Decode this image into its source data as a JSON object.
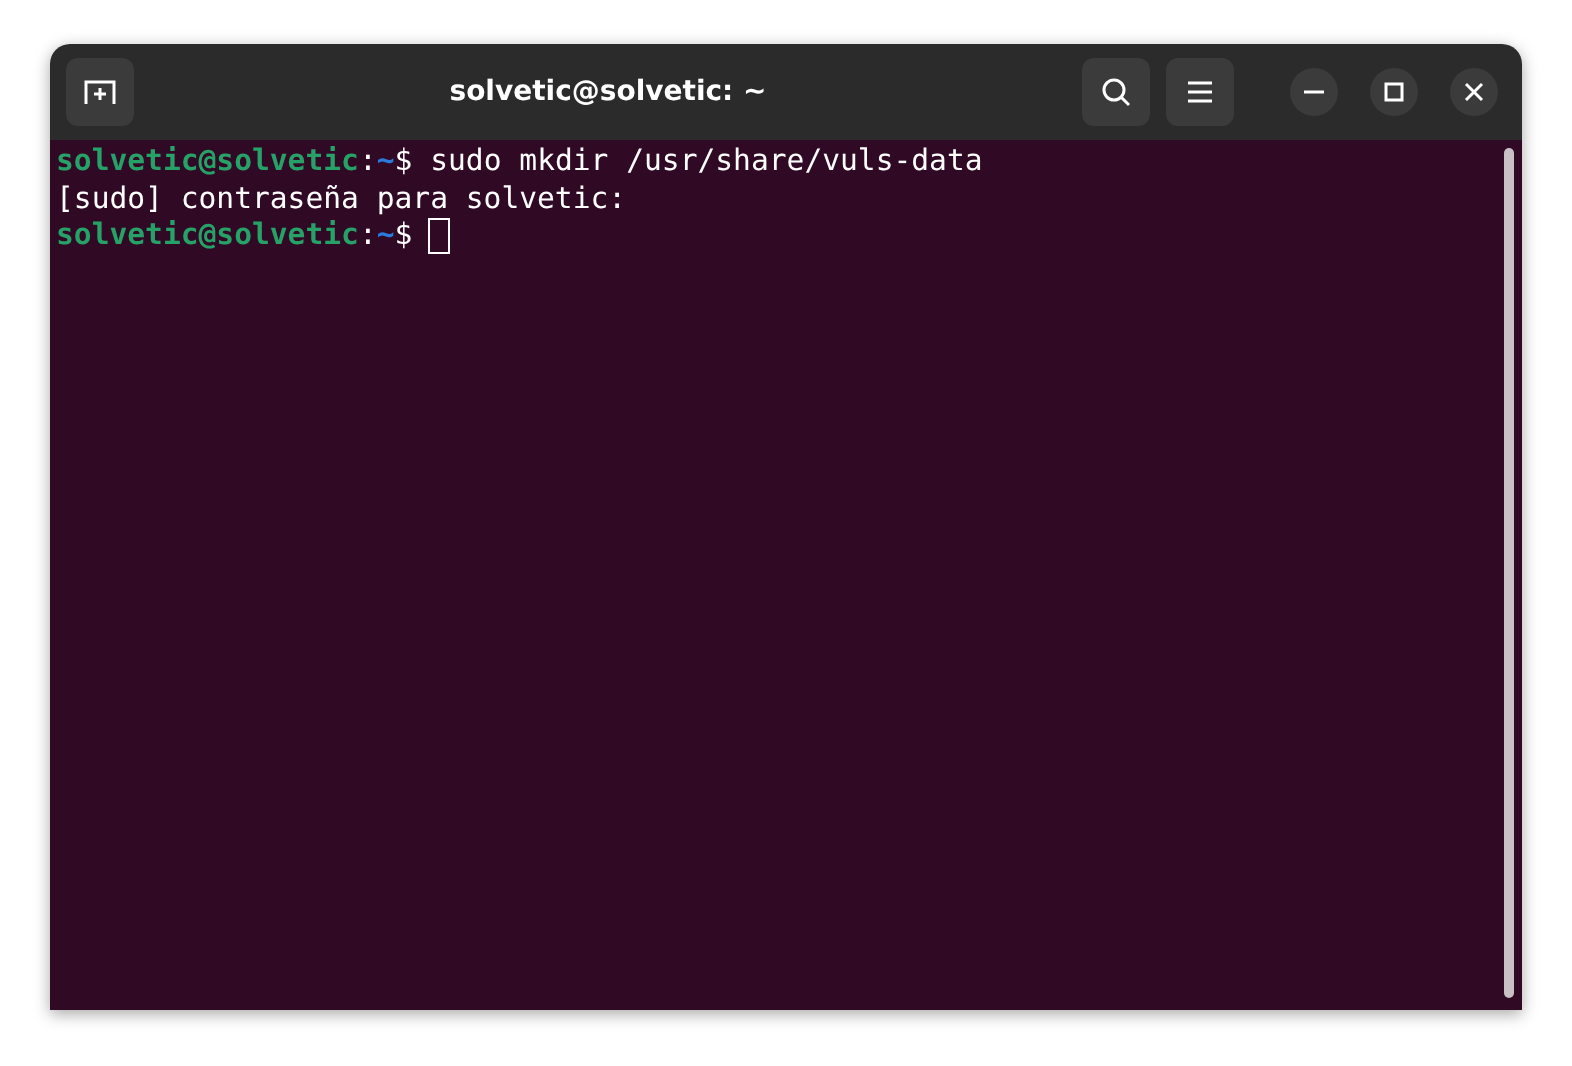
{
  "window": {
    "title": "solvetic@solvetic: ~"
  },
  "lines": [
    {
      "cursor": false,
      "segments": [
        {
          "kind": "user",
          "text": "solvetic@solvetic"
        },
        {
          "kind": "plain",
          "text": ":"
        },
        {
          "kind": "path",
          "text": "~"
        },
        {
          "kind": "plain",
          "text": "$ sudo mkdir /usr/share/vuls-data"
        }
      ]
    },
    {
      "cursor": false,
      "segments": [
        {
          "kind": "plain",
          "text": "[sudo] contraseña para solvetic:"
        }
      ]
    },
    {
      "cursor": true,
      "segments": [
        {
          "kind": "user",
          "text": "solvetic@solvetic"
        },
        {
          "kind": "plain",
          "text": ":"
        },
        {
          "kind": "path",
          "text": "~"
        },
        {
          "kind": "plain",
          "text": "$"
        }
      ]
    }
  ]
}
